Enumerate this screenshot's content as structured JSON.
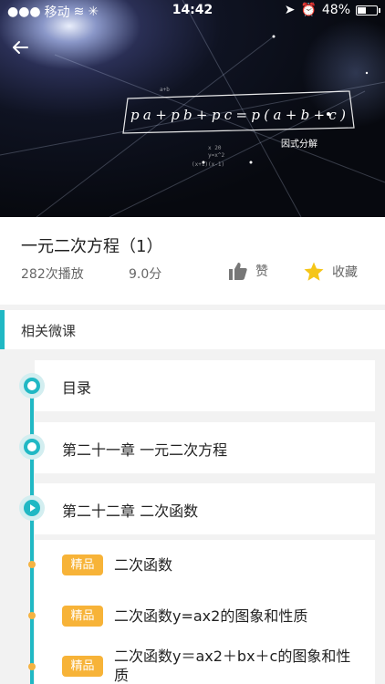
{
  "status_bar": {
    "carrier": "移动",
    "time": "14:42",
    "battery": "48%",
    "battery_level": 0.48
  },
  "video": {
    "formula": "pa+pb+pc=p(a+b+c)",
    "caption": "因式分解"
  },
  "lesson": {
    "title": "一元二次方程（1）",
    "plays": "282次播放",
    "score": "9.0分",
    "like_label": "赞",
    "favorite_label": "收藏"
  },
  "related": {
    "heading": "相关微课",
    "chapters": [
      {
        "label": "目录"
      },
      {
        "label": "第二十一章 一元二次方程"
      },
      {
        "label": "第二十二章 二次函数"
      }
    ],
    "items": [
      {
        "badge": "精品",
        "title": "二次函数"
      },
      {
        "badge": "精品",
        "title": "二次函数y=ax2的图象和性质"
      },
      {
        "badge": "精品",
        "title": "二次函数y＝ax2＋bx＋c的图象和性质"
      }
    ]
  },
  "colors": {
    "accent": "#20b8c4",
    "badge": "#f7b338",
    "star": "#f5c518"
  }
}
